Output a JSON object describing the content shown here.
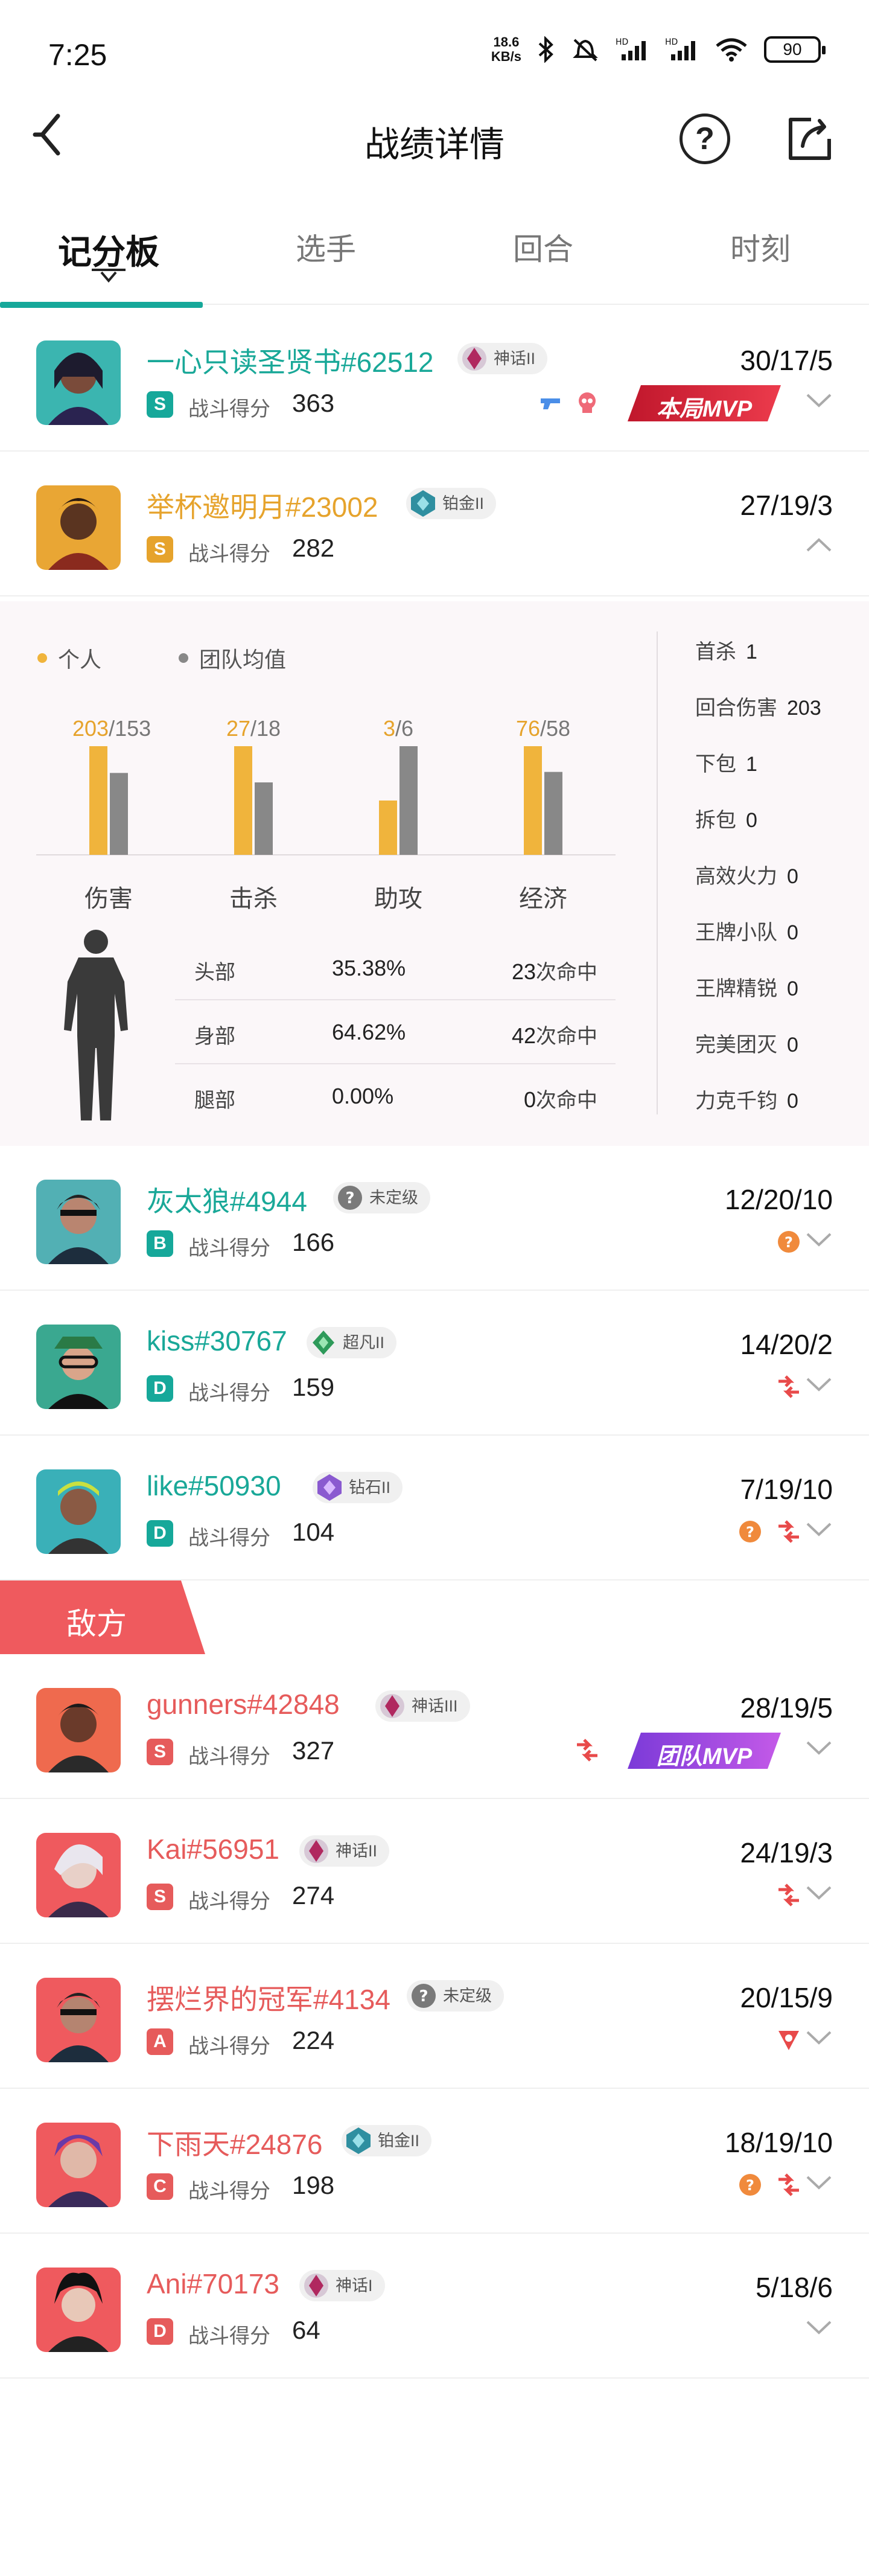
{
  "status_bar": {
    "time": "7:25",
    "net_speed_value": "18.6",
    "net_speed_unit": "KB/s",
    "battery": "90"
  },
  "header": {
    "title": "战绩详情"
  },
  "tabs": [
    {
      "label": "记分板",
      "active": true
    },
    {
      "label": "选手",
      "active": false
    },
    {
      "label": "回合",
      "active": false
    },
    {
      "label": "时刻",
      "active": false
    }
  ],
  "score_label": "战斗得分",
  "team_players": [
    {
      "name": "一心只读圣贤书#62512",
      "rank": "神话II",
      "grade": "S",
      "score": "363",
      "kda": "30/17/5",
      "mvp": "本局MVP"
    },
    {
      "name": "举杯邀明月#23002",
      "rank": "铂金II",
      "grade": "S",
      "score": "282",
      "kda": "27/19/3"
    },
    {
      "name": "灰太狼#4944",
      "rank": "未定级",
      "grade": "B",
      "score": "166",
      "kda": "12/20/10"
    },
    {
      "name": "kiss#30767",
      "rank": "超凡II",
      "grade": "D",
      "score": "159",
      "kda": "14/20/2"
    },
    {
      "name": "like#50930",
      "rank": "钻石II",
      "grade": "D",
      "score": "104",
      "kda": "7/19/10"
    }
  ],
  "expanded": {
    "legend_personal": "个人",
    "legend_team_avg": "团队均值",
    "chart_data": {
      "type": "bar",
      "categories": [
        "伤害",
        "击杀",
        "助攻",
        "经济"
      ],
      "series": [
        {
          "name": "个人",
          "values": [
            203,
            27,
            3,
            76
          ]
        },
        {
          "name": "团队均值",
          "values": [
            153,
            18,
            6,
            58
          ]
        }
      ],
      "colors": [
        "#f0b43c",
        "#888888"
      ]
    },
    "hits": [
      {
        "part": "头部",
        "pct": "35.38%",
        "count": "23",
        "unit": "次命中"
      },
      {
        "part": "身部",
        "pct": "64.62%",
        "count": "42",
        "unit": "次命中"
      },
      {
        "part": "腿部",
        "pct": "0.00%",
        "count": "0",
        "unit": "次命中"
      }
    ],
    "side_stats": [
      {
        "label": "首杀",
        "value": "1"
      },
      {
        "label": "回合伤害",
        "value": "203"
      },
      {
        "label": "下包",
        "value": "1"
      },
      {
        "label": "拆包",
        "value": "0"
      },
      {
        "label": "高效火力",
        "value": "0"
      },
      {
        "label": "王牌小队",
        "value": "0"
      },
      {
        "label": "王牌精锐",
        "value": "0"
      },
      {
        "label": "完美团灭",
        "value": "0"
      },
      {
        "label": "力克千钧",
        "value": "0"
      }
    ]
  },
  "enemy_label": "敌方",
  "enemy_players": [
    {
      "name": "gunners#42848",
      "rank": "神话III",
      "grade": "S",
      "score": "327",
      "kda": "28/19/5",
      "mvp": "团队MVP"
    },
    {
      "name": "Kai#56951",
      "rank": "神话II",
      "grade": "S",
      "score": "274",
      "kda": "24/19/3"
    },
    {
      "name": "摆烂界的冠军#4134",
      "rank": "未定级",
      "grade": "A",
      "score": "224",
      "kda": "20/15/9"
    },
    {
      "name": "下雨天#24876",
      "rank": "铂金II",
      "grade": "C",
      "score": "198",
      "kda": "18/19/10"
    },
    {
      "name": "Ani#70173",
      "rank": "神话I",
      "grade": "D",
      "score": "64",
      "kda": "5/18/6"
    }
  ],
  "colors": {
    "accent": "#16a89a",
    "team": "#19a898",
    "enemy": "#e65b5b",
    "personal": "#f0b43c",
    "team_avg": "#888888"
  }
}
